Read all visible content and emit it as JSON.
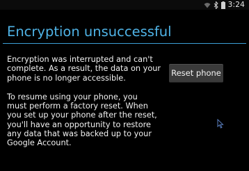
{
  "status_bar": {
    "time": "3:24",
    "icons": [
      "wifi-icon",
      "bluetooth-icon",
      "battery-icon"
    ]
  },
  "dialog": {
    "title": "Encryption unsuccessful",
    "paragraph_1_lines": [
      "Encryption was interrupted and can't",
      "complete. As a result, the data on your",
      "phone is no longer accessible."
    ],
    "paragraph_2_lines": [
      "To resume using your phone, you",
      "must perform a factory reset. When",
      "you set up your phone after the reset,",
      "you'll have an opportunity to restore",
      "any data that was backed up to your",
      "Google Account."
    ],
    "reset_button_label": "Reset phone"
  },
  "colors": {
    "title": "#4fb3e6",
    "divider": "#3b9fd6",
    "background": "#000000",
    "button": "#3a3a3a"
  }
}
